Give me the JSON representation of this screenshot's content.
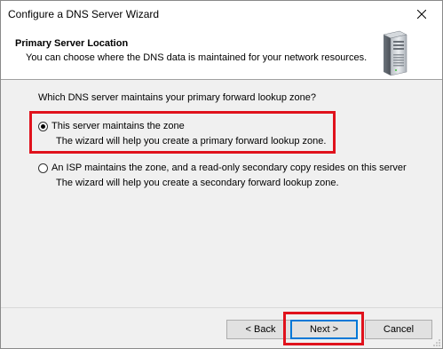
{
  "window": {
    "title": "Configure a DNS Server Wizard",
    "close_label": "✕"
  },
  "header": {
    "title": "Primary Server Location",
    "subtitle": "You can choose where the DNS data is maintained for your network resources."
  },
  "body": {
    "question": "Which DNS server maintains your primary forward lookup zone?",
    "options": [
      {
        "label": "This server maintains the zone",
        "description": "The wizard will help you create a primary forward lookup zone.",
        "selected": true
      },
      {
        "label": "An ISP maintains the zone, and a read-only secondary copy resides on this server",
        "description": "The wizard will help you create a secondary forward lookup zone.",
        "selected": false
      }
    ]
  },
  "buttons": {
    "back": "< Back",
    "next": "Next >",
    "cancel": "Cancel"
  },
  "colors": {
    "highlight": "#e0121c",
    "focus": "#0078d7"
  }
}
